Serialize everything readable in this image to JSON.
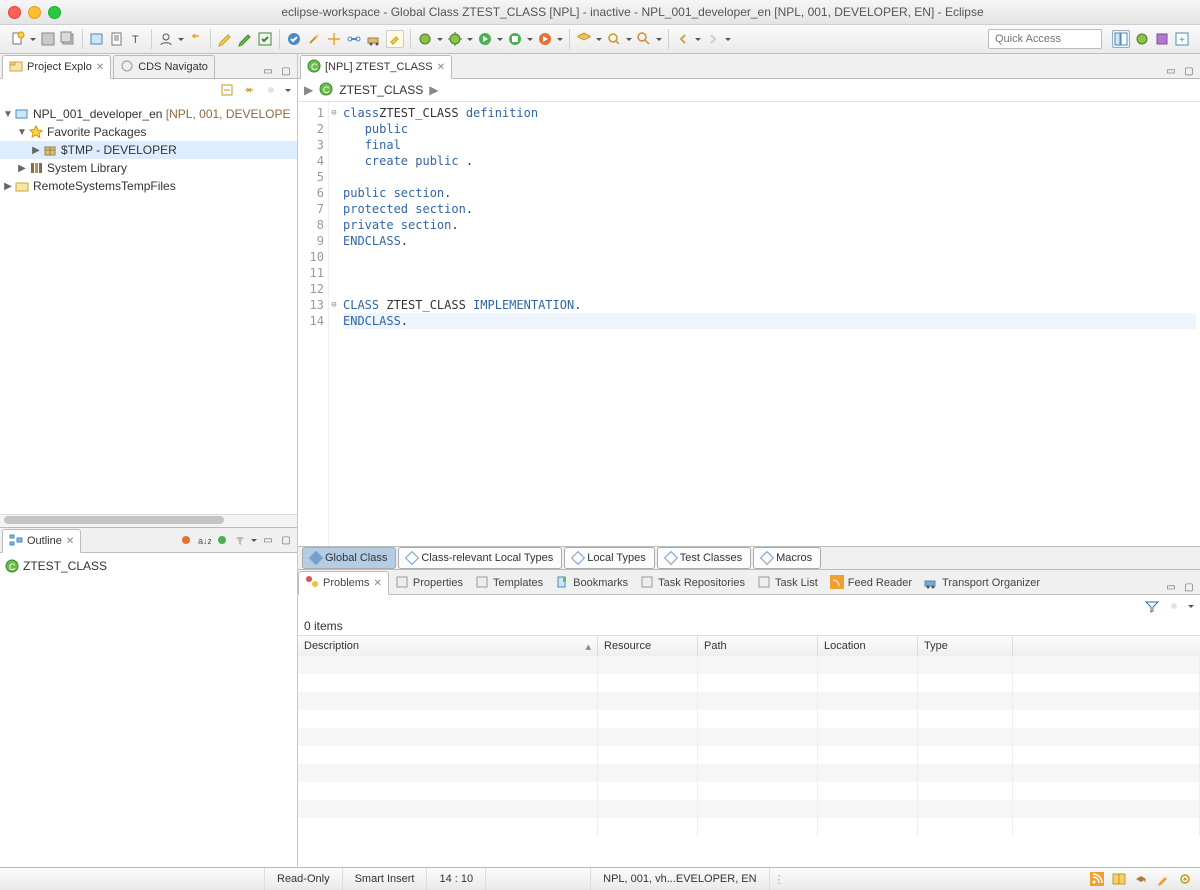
{
  "window_title": "eclipse-workspace - Global Class ZTEST_CLASS [NPL] - inactive - NPL_001_developer_en [NPL, 001, DEVELOPER, EN] - Eclipse",
  "quick_access_placeholder": "Quick Access",
  "left_views": {
    "explorer": {
      "title": "Project Explo",
      "suffix": "[NPL, 001, DEVELOPE"
    },
    "navigator": {
      "title": "CDS Navigato"
    }
  },
  "project_tree": {
    "project": "NPL_001_developer_en",
    "project_suffix": "[NPL, 001, DEVELOPE",
    "favorites": "Favorite Packages",
    "tmp": "$TMP - DEVELOPER",
    "syslib": "System Library",
    "remote": "RemoteSystemsTempFiles"
  },
  "outline": {
    "title": "Outline",
    "root": "ZTEST_CLASS"
  },
  "editor": {
    "tab_title": "[NPL] ZTEST_CLASS",
    "breadcrumb": "ZTEST_CLASS",
    "subtabs": [
      "Global Class",
      "Class-relevant Local Types",
      "Local Types",
      "Test Classes",
      "Macros"
    ],
    "code": [
      {
        "n": 1,
        "fold": "⊖",
        "tokens": [
          [
            "kw",
            "class"
          ],
          [
            " ",
            ""
          ],
          [
            "",
            "ZTEST_CLASS "
          ],
          [
            "kw",
            "definition"
          ]
        ]
      },
      {
        "n": 2,
        "tokens": [
          [
            "",
            "   "
          ],
          [
            "kw",
            "public"
          ]
        ]
      },
      {
        "n": 3,
        "tokens": [
          [
            "",
            "   "
          ],
          [
            "kw",
            "final"
          ]
        ]
      },
      {
        "n": 4,
        "tokens": [
          [
            "",
            "   "
          ],
          [
            "kw",
            "create public"
          ],
          [
            "",
            " ."
          ]
        ]
      },
      {
        "n": 5,
        "tokens": []
      },
      {
        "n": 6,
        "tokens": [
          [
            "kw",
            "public section"
          ],
          [
            "",
            "."
          ]
        ]
      },
      {
        "n": 7,
        "tokens": [
          [
            "kw",
            "protected section"
          ],
          [
            "",
            "."
          ]
        ]
      },
      {
        "n": 8,
        "tokens": [
          [
            "kw",
            "private section"
          ],
          [
            "",
            "."
          ]
        ]
      },
      {
        "n": 9,
        "tokens": [
          [
            "kw",
            "ENDCLASS"
          ],
          [
            "",
            "."
          ]
        ]
      },
      {
        "n": 10,
        "tokens": []
      },
      {
        "n": 11,
        "tokens": []
      },
      {
        "n": 12,
        "tokens": []
      },
      {
        "n": 13,
        "fold": "⊖",
        "tokens": [
          [
            "kw",
            "CLASS"
          ],
          [
            "",
            " ZTEST_CLASS "
          ],
          [
            "kw",
            "IMPLEMENTATION"
          ],
          [
            "",
            "."
          ]
        ]
      },
      {
        "n": 14,
        "cur": true,
        "tokens": [
          [
            "kw",
            "ENDCLASS"
          ],
          [
            "",
            "."
          ]
        ]
      }
    ]
  },
  "bottom_tabs": [
    {
      "icon": "problems",
      "label": "Problems",
      "active": true
    },
    {
      "icon": "properties",
      "label": "Properties"
    },
    {
      "icon": "templates",
      "label": "Templates"
    },
    {
      "icon": "bookmarks",
      "label": "Bookmarks"
    },
    {
      "icon": "taskrepo",
      "label": "Task Repositories"
    },
    {
      "icon": "tasklist",
      "label": "Task List"
    },
    {
      "icon": "feed",
      "label": "Feed Reader"
    },
    {
      "icon": "transport",
      "label": "Transport Organizer"
    }
  ],
  "problems": {
    "count_label": "0 items",
    "columns": [
      "Description",
      "Resource",
      "Path",
      "Location",
      "Type"
    ]
  },
  "status_bar": {
    "mode": "Read-Only",
    "insert": "Smart Insert",
    "pos": "14 : 10",
    "conn": "NPL, 001, vh...EVELOPER, EN"
  }
}
